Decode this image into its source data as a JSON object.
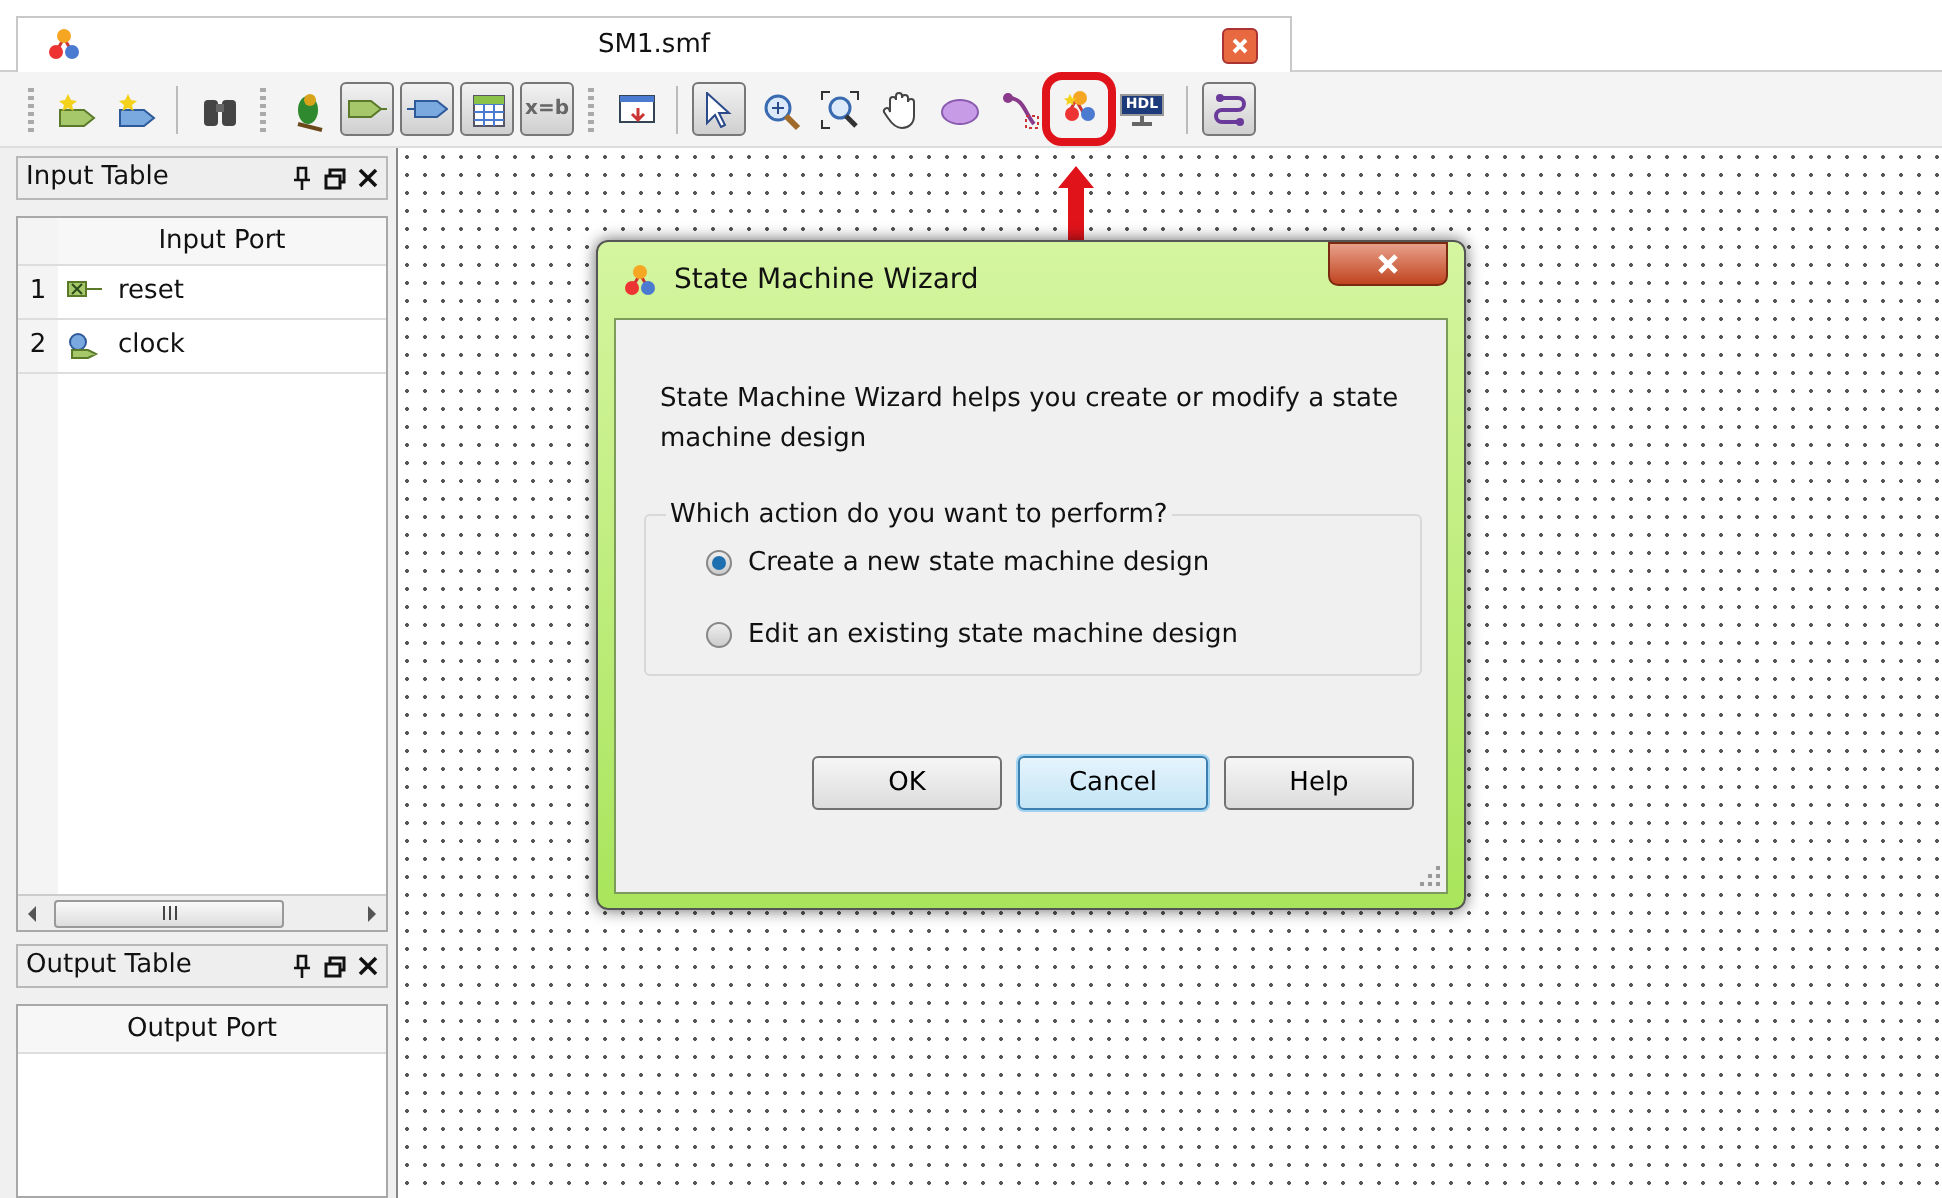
{
  "document_tab": {
    "title": "SM1.smf"
  },
  "toolbar": [
    {
      "kind": "new-input",
      "pressed": false,
      "highlighted": false
    },
    {
      "kind": "new-output",
      "pressed": false,
      "highlighted": false
    },
    {
      "kind": "separator"
    },
    {
      "kind": "find",
      "pressed": false,
      "highlighted": false
    },
    {
      "kind": "grip"
    },
    {
      "kind": "bird",
      "pressed": false,
      "highlighted": false
    },
    {
      "kind": "port-in",
      "pressed": true,
      "highlighted": false
    },
    {
      "kind": "port-out",
      "pressed": true,
      "highlighted": false
    },
    {
      "kind": "table",
      "pressed": true,
      "highlighted": false
    },
    {
      "kind": "text",
      "label": "x=b",
      "pressed": true,
      "highlighted": false
    },
    {
      "kind": "grip"
    },
    {
      "kind": "window",
      "pressed": false,
      "highlighted": false
    },
    {
      "kind": "separator"
    },
    {
      "kind": "pointer",
      "pressed": true,
      "highlighted": false
    },
    {
      "kind": "zoom-in",
      "pressed": false,
      "highlighted": false
    },
    {
      "kind": "zoom-fit",
      "pressed": false,
      "highlighted": false
    },
    {
      "kind": "hand",
      "pressed": false,
      "highlighted": false
    },
    {
      "kind": "ellipse",
      "pressed": false,
      "highlighted": false
    },
    {
      "kind": "transition",
      "pressed": false,
      "highlighted": false
    },
    {
      "kind": "wizard",
      "pressed": false,
      "highlighted": true
    },
    {
      "kind": "monitor",
      "label": "HDL",
      "pressed": false,
      "highlighted": false
    },
    {
      "kind": "separator"
    },
    {
      "kind": "link",
      "pressed": true,
      "highlighted": false
    }
  ],
  "input_table": {
    "title": "Input Table",
    "column": "Input Port",
    "rows": [
      {
        "number": "1",
        "name": "reset",
        "kind": "input"
      },
      {
        "number": "2",
        "name": "clock",
        "kind": "clock"
      }
    ]
  },
  "output_table": {
    "title": "Output Table",
    "column": "Output Port"
  },
  "dialog": {
    "title": "State Machine Wizard",
    "message": "State Machine Wizard helps you create or modify a state machine design",
    "group_label": "Which action do you want to perform?",
    "options": [
      {
        "label": "Create a new state machine design",
        "selected": true
      },
      {
        "label": "Edit an existing state machine design",
        "selected": false
      }
    ],
    "buttons": [
      {
        "label": "OK",
        "focused": false
      },
      {
        "label": "Cancel",
        "focused": true
      },
      {
        "label": "Help",
        "focused": false
      }
    ]
  }
}
